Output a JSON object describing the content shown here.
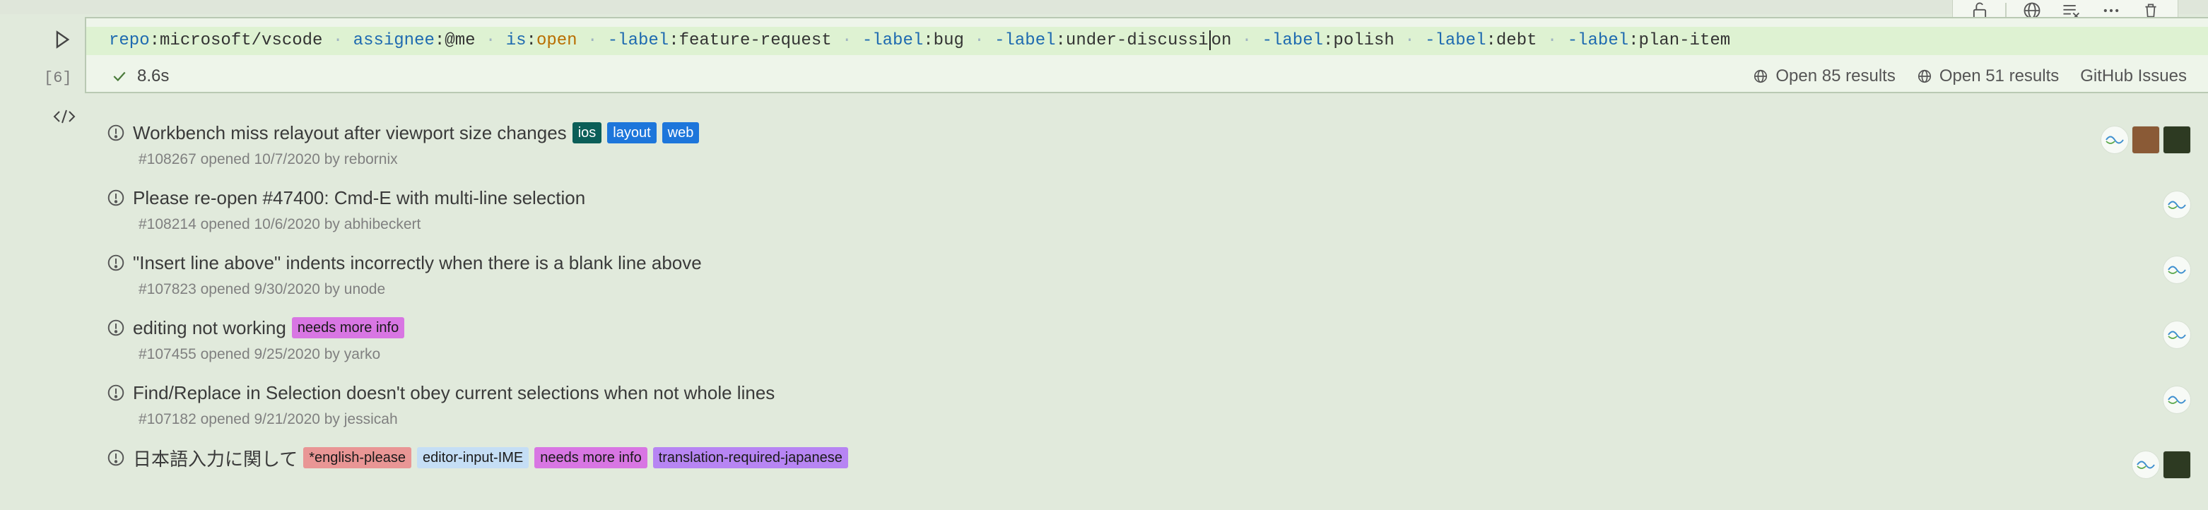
{
  "cell": {
    "exec_count": "[6]",
    "query_tokens": [
      {
        "t": "repo",
        "c": "key"
      },
      {
        "t": ":microsoft/vscode",
        "c": "val"
      },
      {
        "t": " · ",
        "c": "dot"
      },
      {
        "t": "assignee",
        "c": "key"
      },
      {
        "t": ":@me",
        "c": "val"
      },
      {
        "t": " · ",
        "c": "dot"
      },
      {
        "t": "is",
        "c": "key"
      },
      {
        "t": ":",
        "c": "val"
      },
      {
        "t": "open",
        "c": "open"
      },
      {
        "t": " · ",
        "c": "dot"
      },
      {
        "t": "-label",
        "c": "key"
      },
      {
        "t": ":feature-request",
        "c": "val"
      },
      {
        "t": " · ",
        "c": "dot"
      },
      {
        "t": "-label",
        "c": "key"
      },
      {
        "t": ":bug",
        "c": "val"
      },
      {
        "t": " · ",
        "c": "dot"
      },
      {
        "t": "-label",
        "c": "key"
      },
      {
        "t": ":under-discussi",
        "c": "val"
      },
      {
        "t": "|",
        "c": "cursor"
      },
      {
        "t": "on",
        "c": "val"
      },
      {
        "t": " · ",
        "c": "dot"
      },
      {
        "t": "-label",
        "c": "key"
      },
      {
        "t": ":polish",
        "c": "val"
      },
      {
        "t": " · ",
        "c": "dot"
      },
      {
        "t": "-label",
        "c": "key"
      },
      {
        "t": ":debt",
        "c": "val"
      },
      {
        "t": " · ",
        "c": "dot"
      },
      {
        "t": "-label",
        "c": "key"
      },
      {
        "t": ":plan-item",
        "c": "val"
      }
    ],
    "duration": "8.6s",
    "links": [
      "Open 85 results",
      "Open 51 results"
    ],
    "provider": "GitHub Issues"
  },
  "toolbar_icons": [
    "unlock-icon",
    "globe-icon",
    "clear-output-icon",
    "more-icon",
    "trash-icon"
  ],
  "issues": [
    {
      "title": "Workbench miss relayout after viewport size changes",
      "meta": "#108267 opened 10/7/2020 by rebornix",
      "labels": [
        {
          "name": "ios",
          "bg": "#0b5e58",
          "fg": "#ffffff"
        },
        {
          "name": "layout",
          "bg": "#1d76db",
          "fg": "#ffffff"
        },
        {
          "name": "web",
          "bg": "#1d76db",
          "fg": "#ffffff"
        }
      ],
      "avatars": [
        "logo",
        "photo1",
        "photo2"
      ]
    },
    {
      "title": "Please re-open #47400: Cmd-E with multi-line selection",
      "meta": "#108214 opened 10/6/2020 by abhibeckert",
      "labels": [],
      "avatars": [
        "logo"
      ]
    },
    {
      "title": "\"Insert line above\" indents incorrectly when there is a blank line above",
      "meta": "#107823 opened 9/30/2020 by unode",
      "labels": [],
      "avatars": [
        "logo"
      ]
    },
    {
      "title": "editing not working",
      "meta": "#107455 opened 9/25/2020 by yarko",
      "labels": [
        {
          "name": "needs more info",
          "bg": "#d876e3",
          "fg": "#1a1a1a"
        }
      ],
      "avatars": [
        "logo"
      ]
    },
    {
      "title": "Find/Replace in Selection doesn't obey current selections when not whole lines",
      "meta": "#107182 opened 9/21/2020 by jessicah",
      "labels": [],
      "avatars": [
        "logo"
      ]
    },
    {
      "title": "日本語入力に関して",
      "meta": "",
      "labels": [
        {
          "name": "*english-please",
          "bg": "#e99695",
          "fg": "#1a1a1a"
        },
        {
          "name": "editor-input-IME",
          "bg": "#c5def5",
          "fg": "#1a1a1a"
        },
        {
          "name": "needs more info",
          "bg": "#d876e3",
          "fg": "#1a1a1a"
        },
        {
          "name": "translation-required-japanese",
          "bg": "#b785f3",
          "fg": "#1a1a1a"
        }
      ],
      "avatars": [
        "logo",
        "photo2"
      ]
    }
  ],
  "colors": {
    "accent": "#1d76db",
    "bg": "#e1eadc"
  }
}
